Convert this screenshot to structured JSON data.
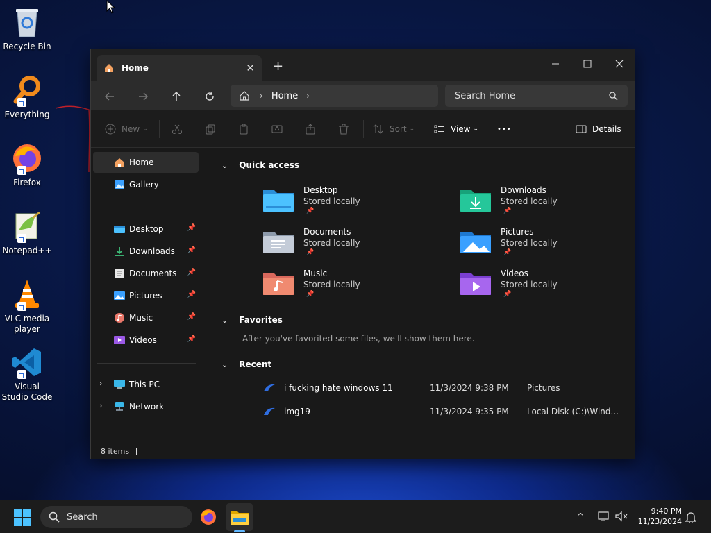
{
  "desktop": {
    "icons": [
      {
        "label": "Recycle Bin",
        "icon": "recycle-bin-icon"
      },
      {
        "label": "Everything",
        "icon": "everything-search-icon"
      },
      {
        "label": "Firefox",
        "icon": "firefox-icon"
      },
      {
        "label": "Notepad++",
        "icon": "notepad-plus-plus-icon"
      },
      {
        "label": "VLC media player",
        "icon": "vlc-icon"
      },
      {
        "label": "Visual Studio Code",
        "icon": "vscode-icon"
      }
    ]
  },
  "window": {
    "tab_title": "Home",
    "tab_close": "✕",
    "new_tab": "+",
    "address": {
      "crumb": "Home",
      "search_placeholder": "Search Home"
    },
    "toolbar": {
      "new_label": "New",
      "sort_label": "Sort",
      "view_label": "View",
      "more_label": "•••",
      "details_label": "Details"
    },
    "sidebar": {
      "top": [
        {
          "label": "Home",
          "icon": "home-icon",
          "selected": true
        },
        {
          "label": "Gallery",
          "icon": "gallery-icon"
        }
      ],
      "pinned": [
        {
          "label": "Desktop",
          "icon": "desktop-folder-icon"
        },
        {
          "label": "Downloads",
          "icon": "downloads-folder-icon"
        },
        {
          "label": "Documents",
          "icon": "documents-folder-icon"
        },
        {
          "label": "Pictures",
          "icon": "pictures-folder-icon"
        },
        {
          "label": "Music",
          "icon": "music-folder-icon"
        },
        {
          "label": "Videos",
          "icon": "videos-folder-icon"
        }
      ],
      "bottom": [
        {
          "label": "This PC",
          "icon": "this-pc-icon"
        },
        {
          "label": "Network",
          "icon": "network-icon"
        }
      ]
    },
    "main": {
      "quick_access_title": "Quick access",
      "quick_access": [
        {
          "name": "Desktop",
          "sub": "Stored locally"
        },
        {
          "name": "Downloads",
          "sub": "Stored locally"
        },
        {
          "name": "Documents",
          "sub": "Stored locally"
        },
        {
          "name": "Pictures",
          "sub": "Stored locally"
        },
        {
          "name": "Music",
          "sub": "Stored locally"
        },
        {
          "name": "Videos",
          "sub": "Stored locally"
        }
      ],
      "favorites_title": "Favorites",
      "favorites_note": "After you've favorited some files, we'll show them here.",
      "recent_title": "Recent",
      "recent": [
        {
          "name": "i fucking hate windows 11",
          "date": "11/3/2024 9:38 PM",
          "location": "Pictures"
        },
        {
          "name": "img19",
          "date": "11/3/2024 9:35 PM",
          "location": "Local Disk (C:)\\Wind..."
        }
      ]
    },
    "status": {
      "items": "8 items"
    }
  },
  "taskbar": {
    "search_label": "Search",
    "time": "9:40 PM",
    "date": "11/23/2024"
  }
}
